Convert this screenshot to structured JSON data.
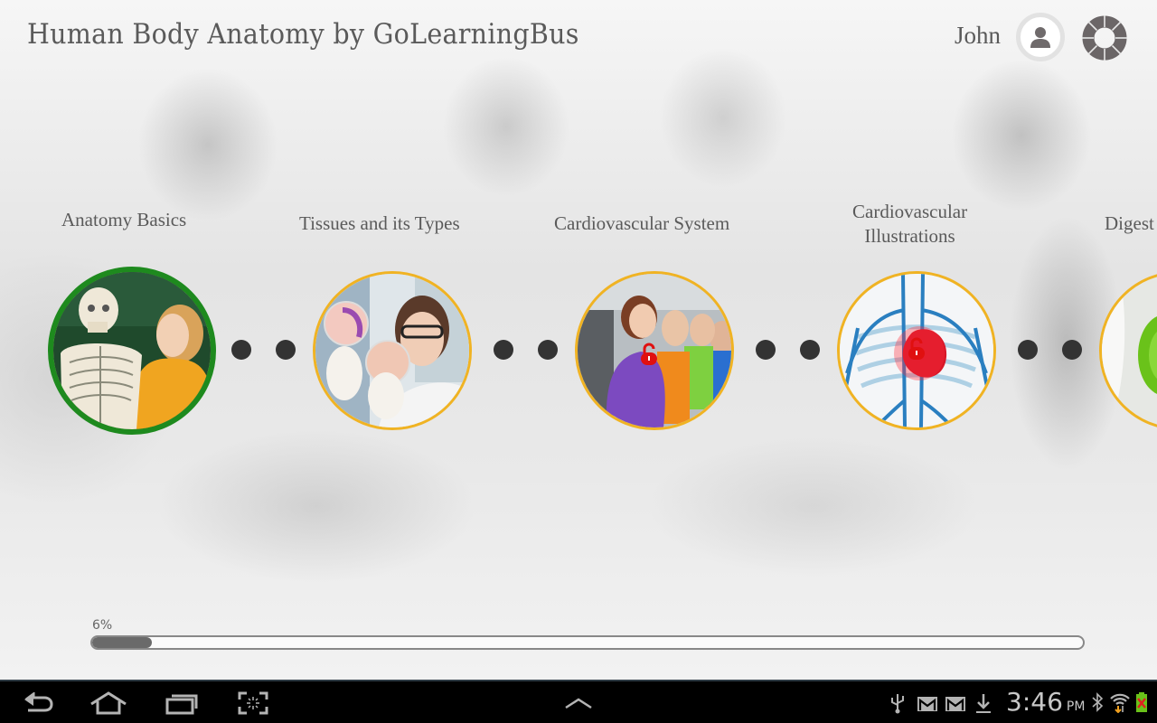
{
  "header": {
    "title": "Human Body Anatomy by GoLearningBus",
    "user_name": "John",
    "avatar_icon": "user-silhouette-icon",
    "settings_icon": "segmented-ring-icon"
  },
  "topics": [
    {
      "label": "Anatomy Basics",
      "image": "skeleton-and-student-photo",
      "state": "completed",
      "border_color": "#1e8a1e"
    },
    {
      "label": "Tissues and its Types",
      "image": "scientist-petri-dish-photo",
      "state": "unlocked",
      "border_color": "#f0b323"
    },
    {
      "label": "Cardiovascular System",
      "image": "runners-gym-photo",
      "state": "locked",
      "border_color": "#f0b323",
      "lock_icon": "red-padlock-icon"
    },
    {
      "label": "Cardiovascular\nIllustrations",
      "label_line1": "Cardiovascular",
      "label_line2": "Illustrations",
      "image": "heart-vessels-illustration",
      "state": "locked",
      "border_color": "#f0b323",
      "lock_icon": "red-padlock-icon"
    },
    {
      "label": "Digest",
      "image": "digestive-system-illustration",
      "state": "partial-visible",
      "border_color": "#f0b323"
    }
  ],
  "progress": {
    "label": "6%",
    "value": 0.06
  },
  "navbar": {
    "back_icon": "back-arrow-icon",
    "home_icon": "home-icon",
    "recent_icon": "recent-apps-icon",
    "screenshot_icon": "screenshot-icon",
    "menu_icon": "chevron-up-icon"
  },
  "status_bar": {
    "icons": [
      "usb-icon",
      "gmail-icon",
      "gmail-icon",
      "download-icon",
      "bluetooth-icon",
      "wifi-icon",
      "battery-charging-icon"
    ],
    "time": "3:46",
    "ampm": "PM"
  },
  "colors": {
    "completed": "#1e8a1e",
    "ring": "#f0b323",
    "lock": "#e01010",
    "text": "#5a5a5a"
  }
}
